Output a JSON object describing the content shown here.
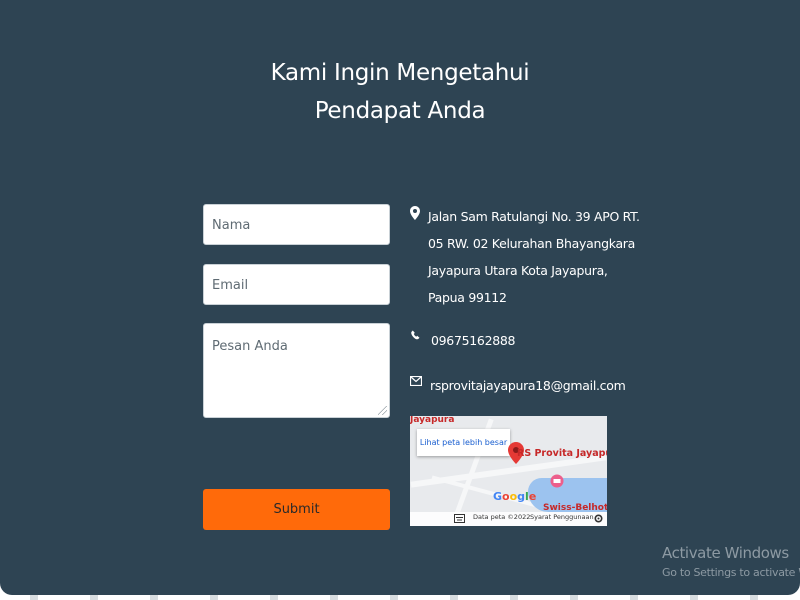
{
  "heading": {
    "line1": "Kami Ingin Mengetahui",
    "line2": "Pendapat Anda"
  },
  "form": {
    "name_placeholder": "Nama",
    "email_placeholder": "Email",
    "message_placeholder": "Pesan Anda",
    "submit_label": "Submit"
  },
  "contact": {
    "address_lines": [
      "Jalan Sam Ratulangi No. 39 APO RT.",
      "05 RW. 02 Kelurahan Bhayangkara",
      "Jayapura Utara Kota Jayapura,",
      "Papua 99112"
    ],
    "phone": "09675162888",
    "email": "rsprovitajayapura18@gmail.com",
    "icons": [
      "map-pin-icon",
      "phone-icon",
      "mail-icon"
    ]
  },
  "map": {
    "area_label": "Jayapura",
    "view_larger": "Lihat peta lebih besar",
    "place_label": "RS Provita Jayapura",
    "nearby_label": "Swiss-Belhotel",
    "google_logo": "Google",
    "data_credit": "Data peta ©2022",
    "terms": "Syarat Penggunaan"
  },
  "os_overlay": {
    "title": "Activate Windows",
    "subtitle": "Go to Settings to activate Windo"
  },
  "colors": {
    "background": "#2e4453",
    "submit": "#ff6a0a",
    "text": "#ffffff"
  }
}
